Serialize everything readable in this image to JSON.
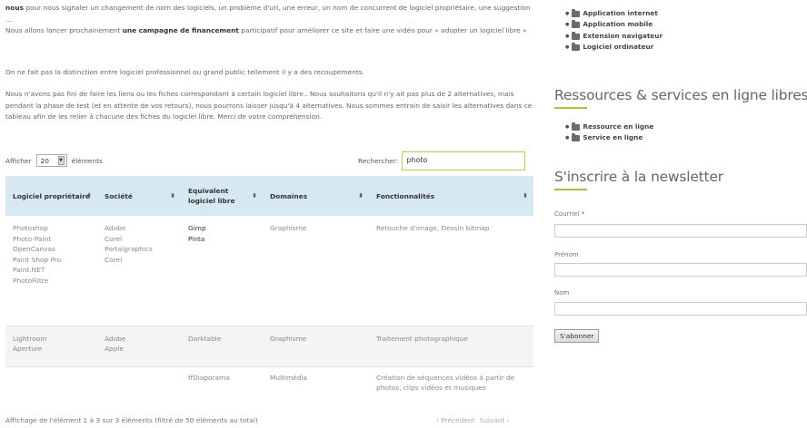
{
  "intro": {
    "p1_lead": "nous",
    "p1_text": " pour nous signaler un changement de nom des logiciels, un problème d'url, une erreur, un nom de concurrent de logiciel propriétaire, une suggestion ...",
    "p1_line2_a": "Nous allons lancer prochainement ",
    "p1_line2_bold": "une campagne de financement",
    "p1_line2_b": " participatif pour améliorer ce site et faire une vidéo pour « adopter un logiciel libre »",
    "p2": "On ne fait pas la distinction entre logiciel professionnel ou grand public tellement il y a des recoupements.",
    "p3": "Nous n'avons pas fini de faire les liens ou les fiches correspondant à certain logiciel libre.. Nous souhaitons qu'il n'y ait pas plus de 2 alternatives, mais pendant la phase de test (et en attente de vos retours), nous pourrons laisser jusqu'à 4 alternatives. Nous sommes entrain de saisir les alternatives dans ce tableau afin de les relier à chacune des fiches du logiciel libre. Merci de votre compréhension."
  },
  "controls": {
    "show_label": "Afficher",
    "page_length": "20",
    "entries_label": "éléments",
    "search_label": "Rechercher:",
    "search_value": "photo"
  },
  "table": {
    "headers": [
      "Logiciel propriétaire",
      "Société",
      "Equivalent logiciel libre",
      "Domaines",
      "Fonctionnalités"
    ],
    "sort_icon": "sort-icon",
    "rows": [
      {
        "proprietary": "Photoshop\nPhoto-Paint\nOpenCanvas\nPaint Shop Pro\nPaint.NET\nPhotoFiltre",
        "company": "Adobe\nCorel\nPortalgraphics\nCorel",
        "free": "Gimp\nPinta",
        "domain": "Graphisme",
        "features": "Retouche d'image, Dessin bitmap"
      },
      {
        "proprietary": "Lightroom\nAperture",
        "company": "Adobe\nApple",
        "free": "Darktable",
        "domain": "Graphisme",
        "features": "Traitement photographique"
      },
      {
        "proprietary": "",
        "company": "",
        "free": "ffDiaporama",
        "domain": "Multimédia",
        "features": "Création de séquences vidéos à partir de photos, clips vidéos et musiques"
      }
    ]
  },
  "footer": {
    "info": "Affichage de l'élément 1 à 3 sur 3 éléments (filtré de 50 éléments au total)",
    "prev": "‹ Précédent",
    "next": "Suivant ›"
  },
  "sidebar": {
    "list1": [
      "Application internet",
      "Application mobile",
      "Extension navigateur",
      "Logiciel ordinateur"
    ],
    "resources_title": "Ressources & services en ligne libres",
    "list2": [
      "Ressource en ligne",
      "Service en ligne"
    ],
    "newsletter_title": "S'inscrire à la newsletter",
    "email_label": "Courriel",
    "required_mark": "*",
    "first_name_label": "Prénom",
    "last_name_label": "Nom",
    "subscribe_label": "S'abonner",
    "folder_icon": "folder-icon",
    "accent_color": "#a5c23a",
    "header_bg": "#d6e8f2"
  }
}
